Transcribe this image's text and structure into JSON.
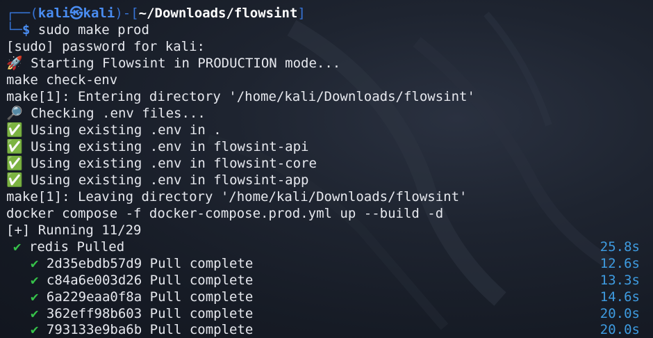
{
  "prompt": {
    "frame_top_left": "┌──(",
    "user": "kali",
    "at_symbol": "㉿",
    "host": "kali",
    "frame_mid": ")-[",
    "cwd": "~/Downloads/flowsint",
    "frame_close": "]",
    "frame_bottom_left": "└─",
    "dollar": "$",
    "command": " sudo make prod"
  },
  "lines": {
    "sudo": "[sudo] password for kali:",
    "rocket_icon": "🚀",
    "starting": " Starting Flowsint in PRODUCTION mode...",
    "make_check": "make check-env",
    "entering": "make[1]: Entering directory '/home/kali/Downloads/flowsint'",
    "mag_icon": "🔎",
    "checking": " Checking .env files...",
    "tick_icon": "✅",
    "env1": " Using existing .env in .",
    "env2": " Using existing .env in flowsint-api",
    "env3": " Using existing .env in flowsint-core",
    "env4": " Using existing .env in flowsint-app",
    "leaving": "make[1]: Leaving directory '/home/kali/Downloads/flowsint'",
    "docker": "docker compose -f docker-compose.prod.yml up --build -d",
    "running": "[+] Running 11/29"
  },
  "pulls": {
    "check_icon": "✔",
    "redis": {
      "text": "redis Pulled",
      "duration": "25.8s"
    },
    "layers": [
      {
        "id": "2d35ebdb57d9",
        "status": "Pull complete",
        "duration": "12.6s"
      },
      {
        "id": "c84a6e003d26",
        "status": "Pull complete",
        "duration": "13.3s"
      },
      {
        "id": "6a229eaa0f8a",
        "status": "Pull complete",
        "duration": "14.6s"
      },
      {
        "id": "362eff98b603",
        "status": "Pull complete",
        "duration": "20.0s"
      },
      {
        "id": "793133e9ba6b",
        "status": "Pull complete",
        "duration": "20.0s"
      }
    ]
  },
  "colors": {
    "prompt_blue": "#4a8df2",
    "frame_blue": "#3674d6",
    "check_green": "#36c24a",
    "duration_blue": "#3e9be0",
    "text": "#e6e8ee",
    "background": "#1b212c"
  }
}
